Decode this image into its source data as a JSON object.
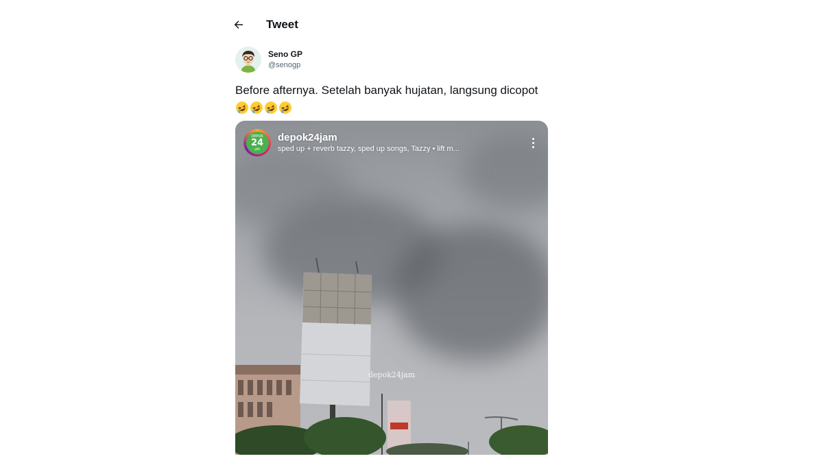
{
  "header": {
    "title": "Tweet",
    "back_icon": "arrow-left-icon"
  },
  "author": {
    "display_name": "Seno GP",
    "handle": "@senogp",
    "avatar_icon": "avatar-illustration"
  },
  "tweet": {
    "text": "Before afternya. Setelah banyak hujatan, langsung dicopot",
    "emoji": [
      "🤣",
      "🤣",
      "🤣",
      "🤣"
    ]
  },
  "media": {
    "account": "depok24jam",
    "music": "sped up + reverb tazzy, sped up songs, Tazzy • lift m...",
    "logo": {
      "top": "DEPOK",
      "mid": "24",
      "bottom": "JAM"
    },
    "watermark": "depok24jam",
    "more_icon": "more-vertical-icon"
  },
  "colors": {
    "text": "#0f1419",
    "secondary": "#536471",
    "logo_green": "#4caf50"
  }
}
